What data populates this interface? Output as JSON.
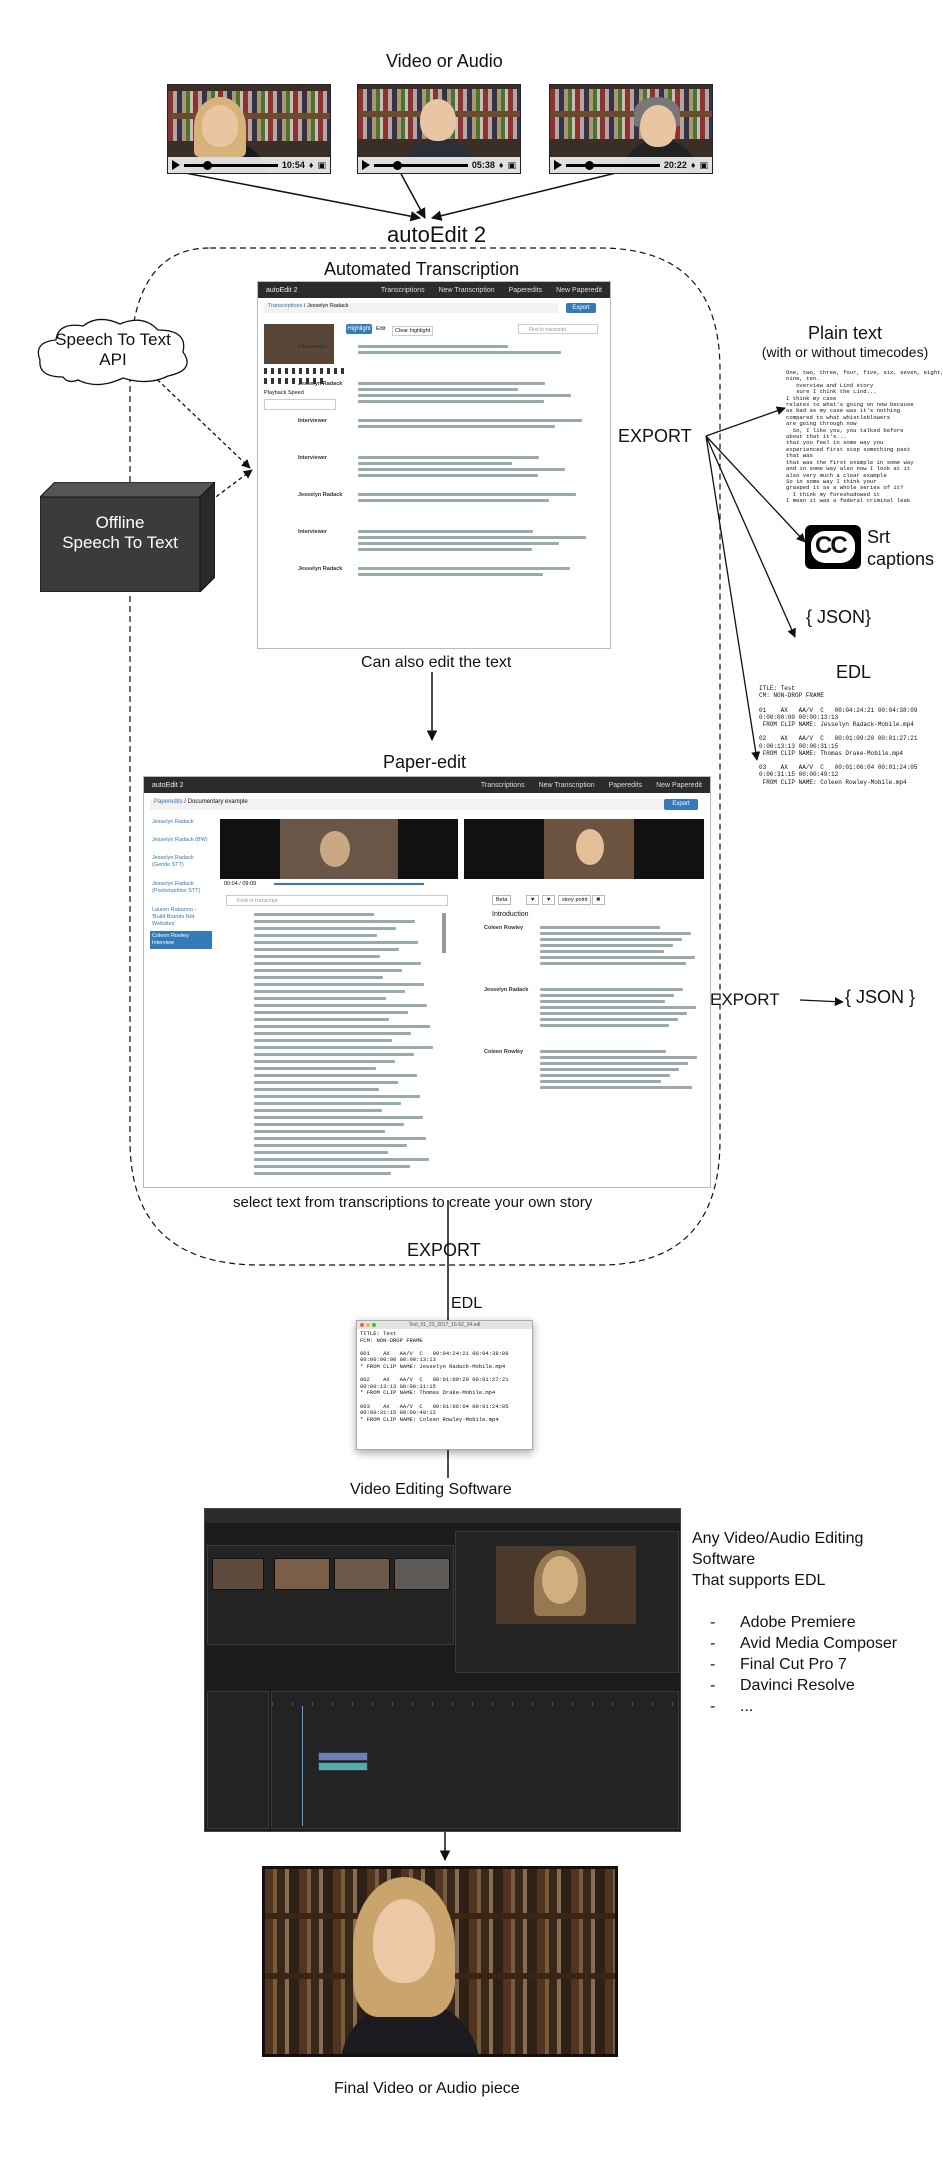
{
  "headings": {
    "video_or_audio": "Video or Audio",
    "autoedit": "autoEdit 2",
    "automated_transcription": "Automated Transcription",
    "can_edit": "Can also edit the text",
    "paper_edit": "Paper-edit",
    "select_text": "select  text from transcriptions to create your own story",
    "export_main": "EXPORT",
    "export_side": "EXPORT",
    "export_paper": "EXPORT",
    "edl_heading": "EDL",
    "video_editing_software": "Video Editing Software",
    "final_piece": "Final Video or Audio piece"
  },
  "thumbs": [
    {
      "time": "10:54"
    },
    {
      "time": "05:38"
    },
    {
      "time": "20:22"
    }
  ],
  "sources": {
    "cloud_line1": "Speech To Text",
    "cloud_line2": "API",
    "box_line1": "Offline",
    "box_line2": "Speech To Text"
  },
  "outputs": {
    "plain_text_title": "Plain text",
    "plain_text_sub": "(with or without timecodes)",
    "srt_icon": "CC",
    "srt_line1": "Srt",
    "srt_line2": "captions",
    "json": "{ JSON}",
    "edl": "EDL",
    "paper_json": "{ JSON }"
  },
  "plain_text_sample": "One, two, three, four, five, six, seven, eight,\nnine, ten.\n   overview and Lind story\n   sure I think the Lind...\nI think my case\nrelates to what's going on now because\nas bad as my case was it's nothing\ncompared to what whistleblowers\nare going through now\n  So, I like you, you talked before\nabout that it's...\nthat you feel in some way you\nexperienced first step something past\nthat was\nthat was the first example in some way\nand in some way also now I look at it\nalso very much a clear example\nSo in some way I think your\ngrasped it as a whole series of it?\n  I think my foreshadowed it\nI mean it was a federal criminal leak\ninvestigation",
  "edl_sample": "ITLE: Test\nCM: NON-DROP FRAME\n\n01    AX   AA/V  C   00:04:24:21 00:04:38:09\n0:00:00:00 00:00:13:13\n FROM CLIP NAME: Jesselyn Radack-Mobile.mp4\n\n02    AX   AA/V  C   00:01:09:20 00:01:27:21\n0:00:13:13 00:00:31:15\n FROM CLIP NAME: Thomas Drake-Mobile.mp4\n\n03    AX   AA/V  C   00:01:06:04 00:01:24:05\n0:00:31:15 00:00:49:12\n FROM CLIP NAME: Coleen Rowley-Mobile.mp4",
  "edl_window": {
    "title": "Test_01_23_2017_16-52_34.edl",
    "content": "TITLE: Test\nFCM: NON-DROP FRAME\n\n001    AX   AA/V  C   00:04:24:21 00:04:38:09\n00:00:00:00 00:00:13:13\n* FROM CLIP NAME: Jesselyn Radack-Mobile.mp4\n\n002    AX   AA/V  C   00:01:09:20 00:01:27:21\n00:00:13:13 00:00:31:15\n* FROM CLIP NAME: Thomas Drake-Mobile.mp4\n\n003    AX   AA/V  C   00:01:06:04 00:01:24:05\n00:00:31:15 00:00:49:12\n* FROM CLIP NAME: Coleen Rowley-Mobile.mp4"
  },
  "transcription_ui": {
    "brand": "autoEdit 2",
    "nav": [
      "Transcriptions",
      "New Transcription",
      "Paperedits",
      "New Paperedit"
    ],
    "crumb1": "Transcriptions",
    "crumb2": "Jesselyn Radack",
    "export": "Export",
    "highlight": "Highlight",
    "edit": "Edit",
    "clear": "Clear highlight",
    "search": "Find in transcript",
    "playback": "Playback Speed",
    "speakers": [
      "Interviewer",
      "Jesselyn Radack",
      "Interviewer",
      "Interviewer",
      "Jesselyn Radack",
      "Interviewer",
      "Jesselyn Radack"
    ]
  },
  "paperedit_ui": {
    "brand": "autoEdit 2",
    "nav": [
      "Transcriptions",
      "New Transcription",
      "Paperedits",
      "New Paperedit"
    ],
    "crumb1": "Paperedits",
    "crumb2": "Documentary example",
    "export": "Export",
    "sidebar": [
      "Jesselyn Radack",
      "Jesselyn Radack (BW)",
      "Jesselyn Radack (Gentle STT)",
      "Jesselyn Radack (Pocketsphinx STT)",
      "Lauren Rabanno - 'Build Brands Not Websites'",
      "Coleen Rowley Interview"
    ],
    "time": "00:04 / 09:09",
    "search": "Find in transcript",
    "intro": "Introduction",
    "speakers": [
      "Coleen Rowley",
      "Jesselyn Radack",
      "Coleen Rowley"
    ],
    "tool_btns": [
      "Beta",
      "▼",
      "▼",
      "story point",
      "✖"
    ]
  },
  "software_text": {
    "line1": "Any Video/Audio Editing",
    "line2": "Software",
    "line3": "That supports EDL",
    "items": [
      "Adobe Premiere",
      "Avid Media Composer",
      "Final Cut Pro 7",
      "Davinci Resolve",
      "..."
    ]
  }
}
